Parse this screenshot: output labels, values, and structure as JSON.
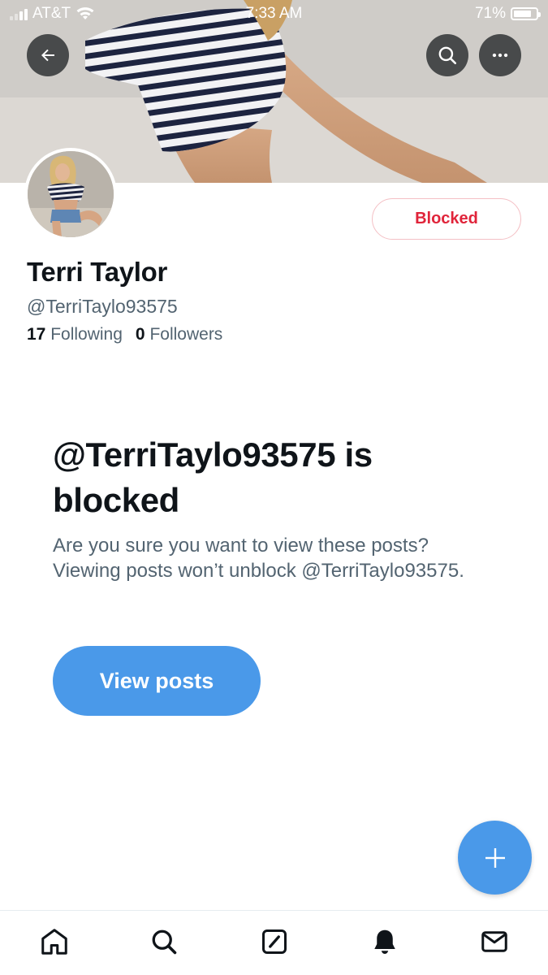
{
  "status_bar": {
    "carrier": "AT&T",
    "time": "7:33 AM",
    "battery": "71%"
  },
  "profile": {
    "display_name": "Terri Taylor",
    "handle": "@TerriTaylo93575",
    "following_count": "17",
    "following_label": "Following",
    "followers_count": "0",
    "followers_label": "Followers",
    "relationship_button": "Blocked"
  },
  "blocked_notice": {
    "title": "@TerriTaylo93575 is blocked",
    "description": "Are you sure you want to view these posts? Viewing posts won’t unblock @TerriTaylo93575.",
    "view_posts_label": "View posts"
  },
  "header_icons": [
    "back-arrow-icon",
    "search-icon",
    "more-icon"
  ],
  "fab_icon": "plus-icon",
  "tab_bar": {
    "items": [
      "home-icon",
      "search-icon",
      "grok-icon",
      "notifications-icon",
      "messages-icon"
    ]
  },
  "colors": {
    "accent": "#4a99e9",
    "blocked_red": "#e0243a",
    "secondary_text": "#536471"
  }
}
